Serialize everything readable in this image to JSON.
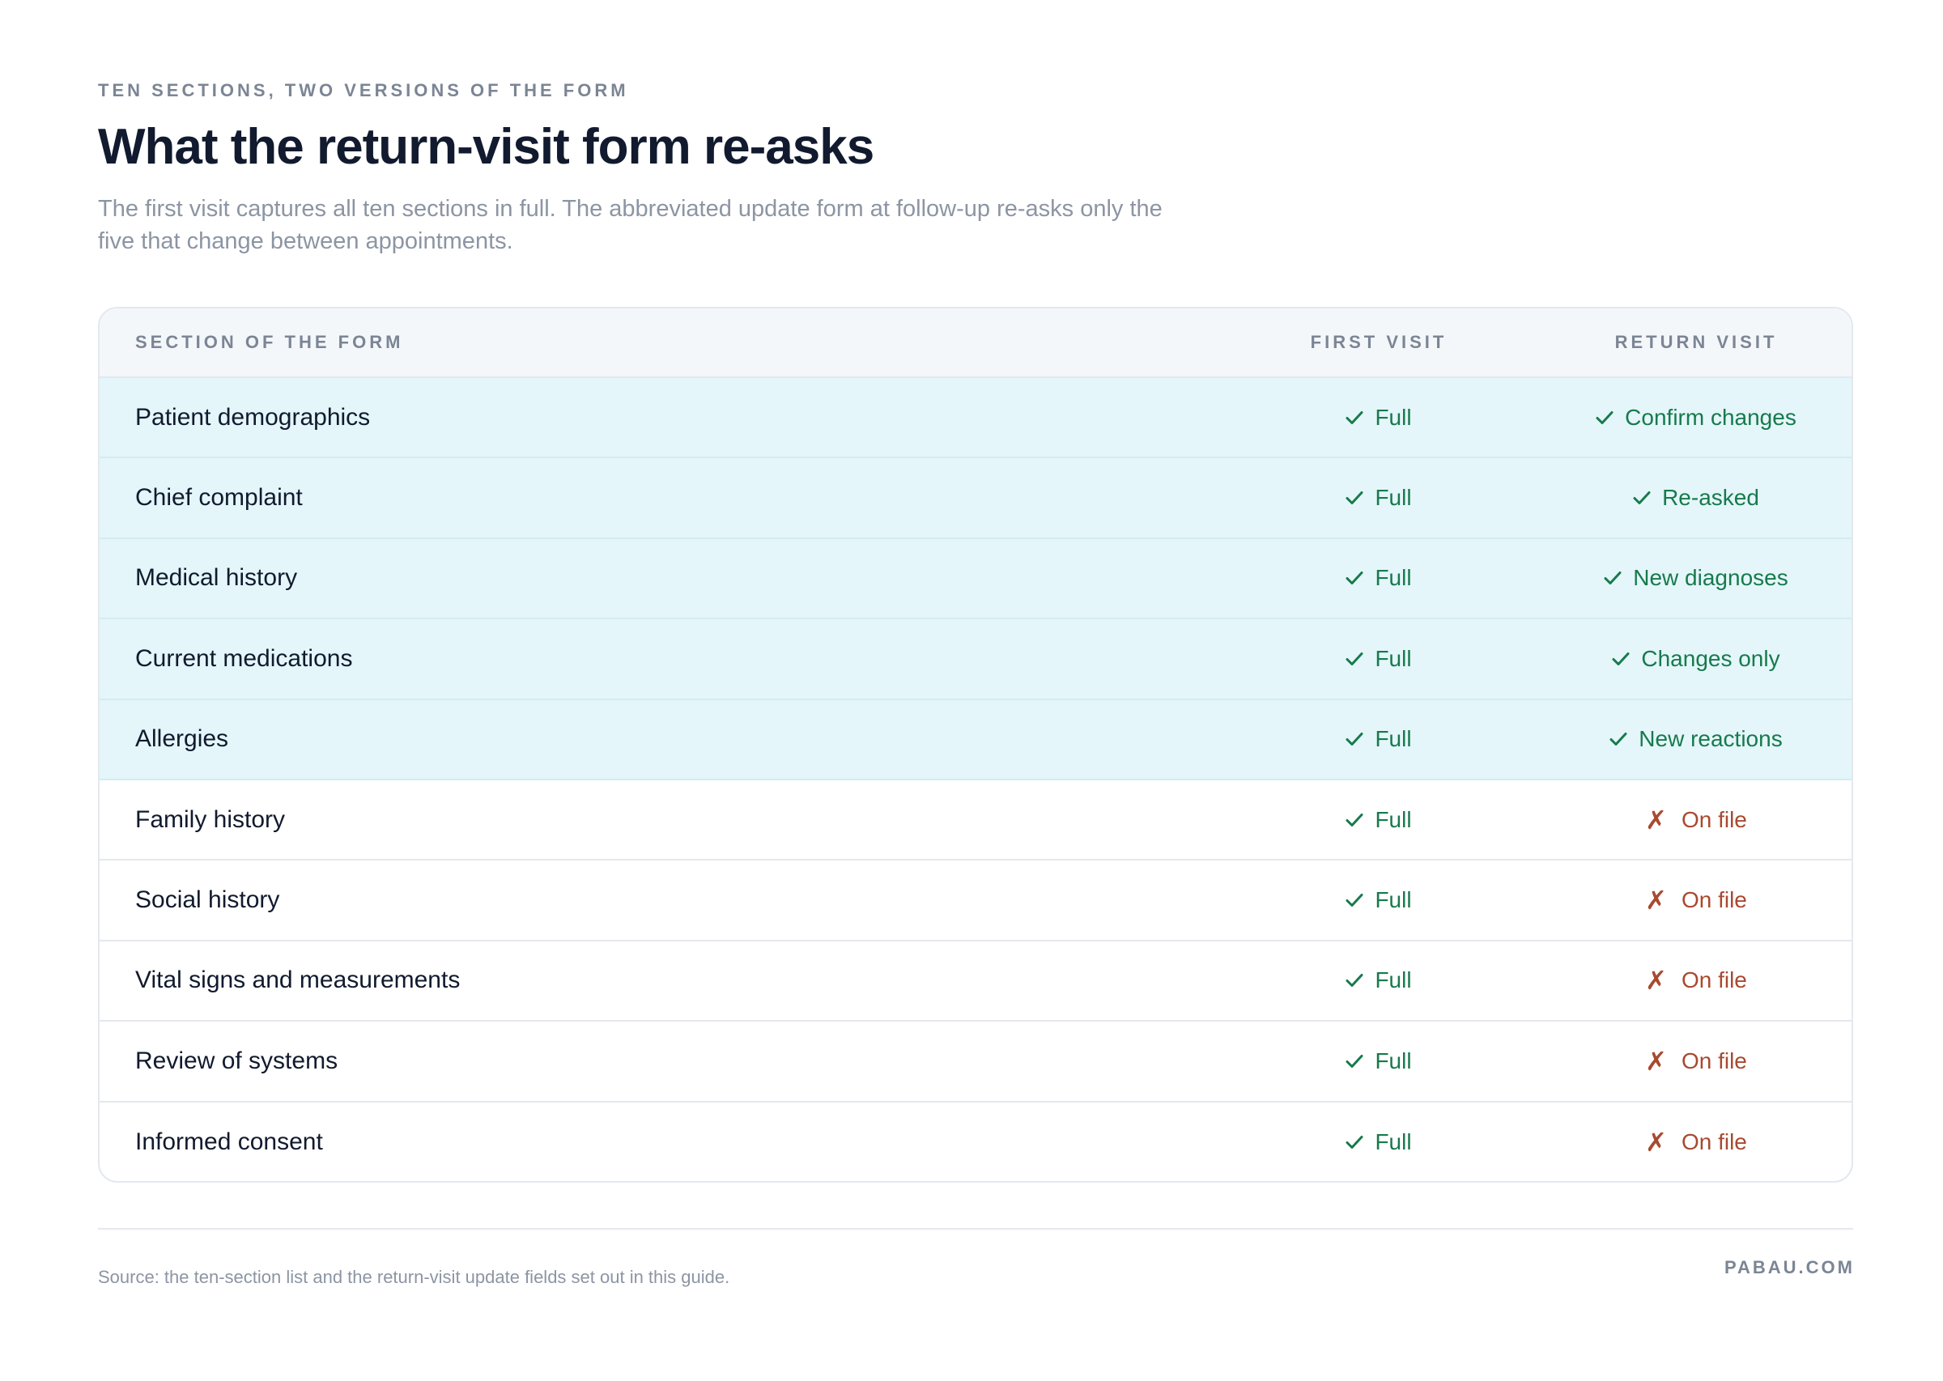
{
  "header": {
    "eyebrow": "TEN SECTIONS, TWO VERSIONS OF THE FORM",
    "title": "What the return-visit form re-asks",
    "subtitle": "The first visit captures all ten sections in full. The abbreviated update form at follow-up re-asks only the five that change between appointments."
  },
  "table": {
    "columns": [
      "SECTION OF THE FORM",
      "FIRST VISIT",
      "RETURN VISIT"
    ],
    "rows": [
      {
        "section": "Patient demographics",
        "first": "Full",
        "return": "Confirm changes",
        "return_status": "re-asked"
      },
      {
        "section": "Chief complaint",
        "first": "Full",
        "return": "Re-asked",
        "return_status": "re-asked"
      },
      {
        "section": "Medical history",
        "first": "Full",
        "return": "New diagnoses",
        "return_status": "re-asked"
      },
      {
        "section": "Current medications",
        "first": "Full",
        "return": "Changes only",
        "return_status": "re-asked"
      },
      {
        "section": "Allergies",
        "first": "Full",
        "return": "New reactions",
        "return_status": "re-asked"
      },
      {
        "section": "Family history",
        "first": "Full",
        "return": "On file",
        "return_status": "not-asked"
      },
      {
        "section": "Social history",
        "first": "Full",
        "return": "On file",
        "return_status": "not-asked"
      },
      {
        "section": "Vital signs and measurements",
        "first": "Full",
        "return": "On file",
        "return_status": "not-asked"
      },
      {
        "section": "Review of systems",
        "first": "Full",
        "return": "On file",
        "return_status": "not-asked"
      },
      {
        "section": "Informed consent",
        "first": "Full",
        "return": "On file",
        "return_status": "not-asked"
      }
    ]
  },
  "footer": {
    "source": "Source: the ten-section list and the return-visit update fields set out in this guide.",
    "brand": "PABAU.COM"
  },
  "icons": {
    "yes": "check-icon",
    "no": "cross-icon"
  },
  "colors": {
    "highlight_row": "#e4f6fa",
    "yes": "#177a4c",
    "no": "#a84a30",
    "title": "#111a2e",
    "muted": "#8c95a3"
  }
}
